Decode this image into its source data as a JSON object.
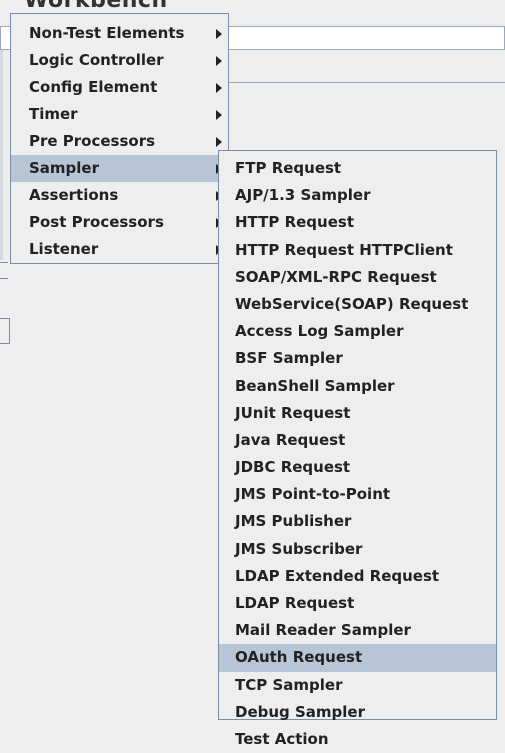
{
  "background": {
    "title": "Workbench"
  },
  "main_menu": {
    "items": [
      {
        "label": "Non-Test Elements",
        "has_submenu": true,
        "selected": false
      },
      {
        "label": "Logic Controller",
        "has_submenu": true,
        "selected": false
      },
      {
        "label": "Config Element",
        "has_submenu": true,
        "selected": false
      },
      {
        "label": "Timer",
        "has_submenu": true,
        "selected": false
      },
      {
        "label": "Pre Processors",
        "has_submenu": true,
        "selected": false
      },
      {
        "label": "Sampler",
        "has_submenu": true,
        "selected": true
      },
      {
        "label": "Assertions",
        "has_submenu": true,
        "selected": false
      },
      {
        "label": "Post Processors",
        "has_submenu": true,
        "selected": false
      },
      {
        "label": "Listener",
        "has_submenu": true,
        "selected": false
      }
    ]
  },
  "sampler_menu": {
    "items": [
      {
        "label": "FTP Request",
        "selected": false
      },
      {
        "label": "AJP/1.3 Sampler",
        "selected": false
      },
      {
        "label": "HTTP Request",
        "selected": false
      },
      {
        "label": "HTTP Request HTTPClient",
        "selected": false
      },
      {
        "label": "SOAP/XML-RPC Request",
        "selected": false
      },
      {
        "label": "WebService(SOAP) Request",
        "selected": false
      },
      {
        "label": "Access Log Sampler",
        "selected": false
      },
      {
        "label": "BSF Sampler",
        "selected": false
      },
      {
        "label": "BeanShell Sampler",
        "selected": false
      },
      {
        "label": "JUnit Request",
        "selected": false
      },
      {
        "label": "Java Request",
        "selected": false
      },
      {
        "label": "JDBC Request",
        "selected": false
      },
      {
        "label": "JMS Point-to-Point",
        "selected": false
      },
      {
        "label": "JMS Publisher",
        "selected": false
      },
      {
        "label": "JMS Subscriber",
        "selected": false
      },
      {
        "label": "LDAP Extended Request",
        "selected": false
      },
      {
        "label": "LDAP Request",
        "selected": false
      },
      {
        "label": "Mail Reader Sampler",
        "selected": false
      },
      {
        "label": "OAuth Request",
        "selected": true
      },
      {
        "label": "TCP Sampler",
        "selected": false
      },
      {
        "label": "Debug Sampler",
        "selected": false
      },
      {
        "label": "Test Action",
        "selected": false
      }
    ]
  },
  "colors": {
    "menu_background": "#eeeeee",
    "menu_border": "#7a8da8",
    "selection": "#b8c5d6",
    "text": "#222222"
  },
  "icons": {
    "submenu_arrow": "submenu-arrow-icon"
  }
}
